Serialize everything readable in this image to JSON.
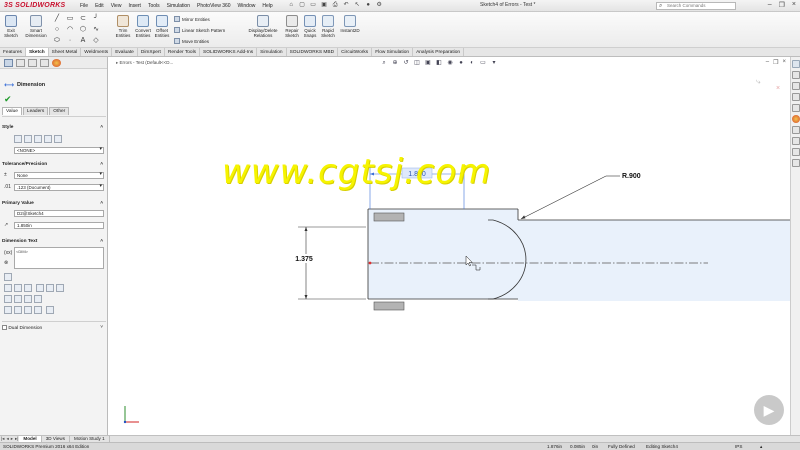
{
  "titlebar": {
    "logo": "3S SOLIDWORKS",
    "menus": [
      "File",
      "Edit",
      "View",
      "Insert",
      "Tools",
      "Simulation",
      "PhotoView 360",
      "Window",
      "Help"
    ],
    "document_title": "Sketch4 of Errors - Test *",
    "search_placeholder": "Search Commands"
  },
  "command_manager": {
    "exit_sketch": "Exit Sketch",
    "smart_dimension": "Smart Dimension",
    "trim_entities": "Trim Entities",
    "convert_entities": "Convert Entities",
    "offset_entities": "Offset Entities",
    "mirror_entities": "Mirror Entities",
    "linear_pattern": "Linear Sketch Pattern",
    "move_entities": "Move Entities",
    "display_delete": "Display/Delete Relations",
    "repair_sketch": "Repair Sketch",
    "quick_snaps": "Quick Snaps",
    "rapid_sketch": "Rapid Sketch",
    "instant2d": "Instant2D"
  },
  "tabs": [
    "Features",
    "Sketch",
    "Sheet Metal",
    "Weldments",
    "Evaluate",
    "DimXpert",
    "Render Tools",
    "SOLIDWORKS Add-Ins",
    "Simulation",
    "SOLIDWORKS MBD",
    "CircuitWorks",
    "Flow Simulation",
    "Analysis Preparation"
  ],
  "property_manager": {
    "title": "Dimension",
    "subtabs": [
      "Value",
      "Leaders",
      "Other"
    ],
    "style_label": "Style",
    "style_value": "<NONE>",
    "tolerance_label": "Tolerance/Precision",
    "tolerance_type": "None",
    "precision": ".123 (Document)",
    "primary_value_label": "Primary Value",
    "primary_ref": "D2@Sketch4",
    "primary_value": "1.850in",
    "dimension_text_label": "Dimension Text",
    "dimension_text_value": "<DIM>",
    "dual_dimension_label": "Dual Dimension"
  },
  "graphics": {
    "breadcrumb": "Errors - Test (Default<<D..."
  },
  "drawing": {
    "dim_horizontal": "1.850",
    "dim_vertical": "1.375",
    "dim_radius": "R.900",
    "watermark": "www.cgtsj.com"
  },
  "bottom_tabs": [
    "Model",
    "3D Views",
    "Motion Study 1"
  ],
  "status": {
    "edition": "SOLIDWORKS Premium 2016 x64 Edition",
    "x": "1.876in",
    "y": "0.085in",
    "z": "0in",
    "state": "Fully Defined",
    "editing": "Editing Sketch4",
    "units": "IPS"
  },
  "colors": {
    "accent_red": "#c8102e",
    "dimension_blue": "#3a6fd8",
    "ok_green": "#1e9a2a",
    "watermark_yellow": "#f6f400",
    "sketch_fill": "#e9f1fb"
  }
}
